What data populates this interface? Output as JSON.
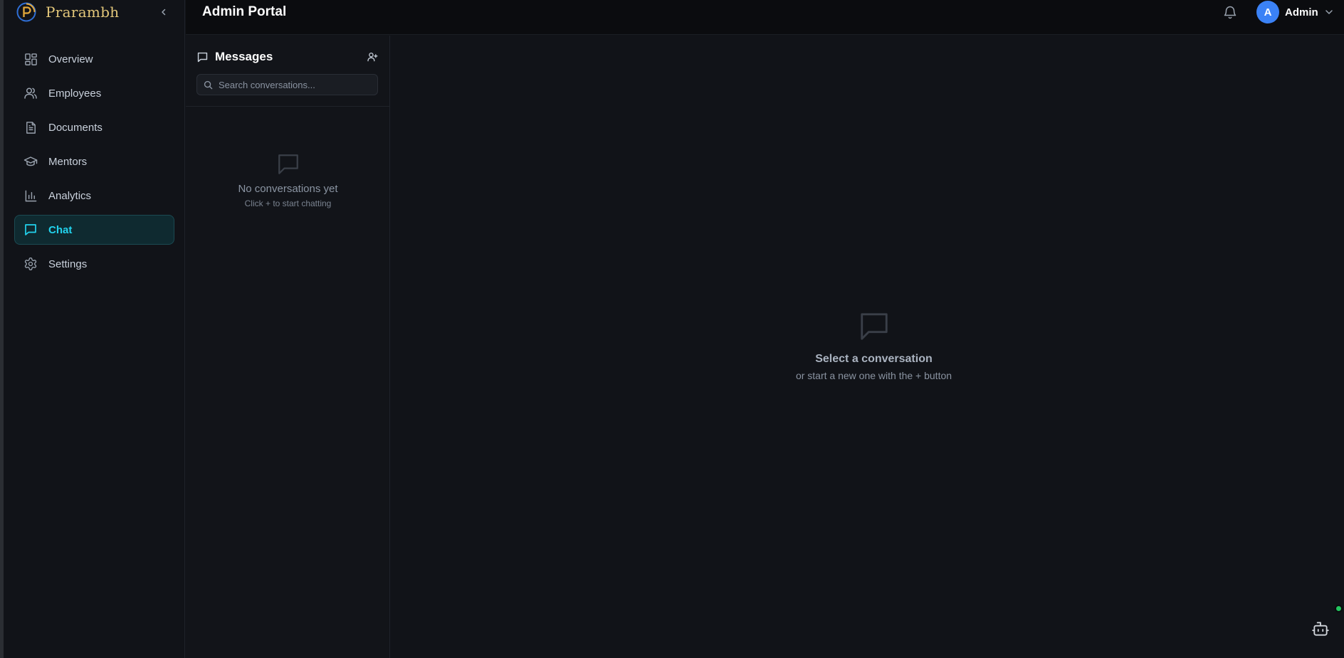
{
  "brand": {
    "name": "Prarambh"
  },
  "topbar": {
    "title": "Admin Portal"
  },
  "user": {
    "initial": "A",
    "name": "Admin"
  },
  "sidebar": {
    "items": [
      {
        "label": "Overview",
        "icon": "layout-grid-icon",
        "active": false
      },
      {
        "label": "Employees",
        "icon": "users-icon",
        "active": false
      },
      {
        "label": "Documents",
        "icon": "file-text-icon",
        "active": false
      },
      {
        "label": "Mentors",
        "icon": "graduation-cap-icon",
        "active": false
      },
      {
        "label": "Analytics",
        "icon": "bar-chart-icon",
        "active": false
      },
      {
        "label": "Chat",
        "icon": "message-square-icon",
        "active": true
      },
      {
        "label": "Settings",
        "icon": "gear-icon",
        "active": false
      }
    ]
  },
  "messages": {
    "title": "Messages",
    "search_placeholder": "Search conversations...",
    "empty_title": "No conversations yet",
    "empty_subtitle": "Click + to start chatting"
  },
  "main": {
    "empty_title": "Select a conversation",
    "empty_subtitle": "or start a new one with the + button"
  },
  "colors": {
    "accent": "#22d3ee",
    "brand_gold": "#e3c77a",
    "avatar_blue": "#3b82f6",
    "status_green": "#22c55e"
  }
}
